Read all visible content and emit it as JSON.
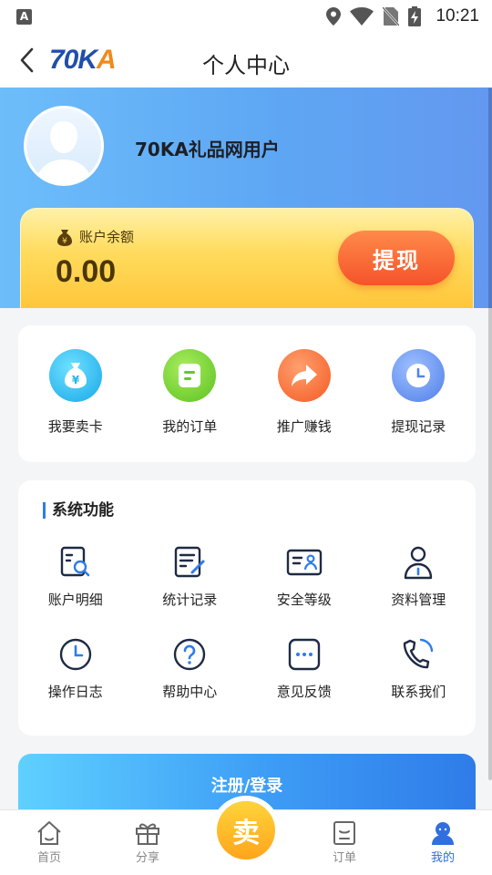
{
  "status": {
    "left_icon": "A",
    "time": "10:21"
  },
  "nav": {
    "title": "个人中心",
    "logo_main": "70K",
    "logo_accent": "A"
  },
  "profile": {
    "username": "70KA礼品网用户"
  },
  "balance": {
    "label": "账户余额",
    "value": "0.00",
    "withdraw_label": "提现"
  },
  "quick_actions": [
    {
      "label": "我要卖卡",
      "icon": "money-bag-icon",
      "color": "#2ec3f0"
    },
    {
      "label": "我的订单",
      "icon": "document-icon",
      "color": "#7cd33a"
    },
    {
      "label": "推广赚钱",
      "icon": "share-arrow-icon",
      "color": "#fa6c3c"
    },
    {
      "label": "提现记录",
      "icon": "clock-icon",
      "color": "#5b8def"
    }
  ],
  "system": {
    "title": "系统功能",
    "items": [
      {
        "label": "账户明细",
        "icon": "account-detail-icon"
      },
      {
        "label": "统计记录",
        "icon": "statistics-icon"
      },
      {
        "label": "安全等级",
        "icon": "id-card-icon"
      },
      {
        "label": "资料管理",
        "icon": "user-icon"
      },
      {
        "label": "操作日志",
        "icon": "clock-icon"
      },
      {
        "label": "帮助中心",
        "icon": "help-icon"
      },
      {
        "label": "意见反馈",
        "icon": "feedback-icon"
      },
      {
        "label": "联系我们",
        "icon": "phone-icon"
      }
    ]
  },
  "login_button": "注册/登录",
  "tabbar": {
    "items": [
      {
        "label": "首页",
        "icon": "home-icon"
      },
      {
        "label": "分享",
        "icon": "gift-icon"
      },
      {
        "label": "卖",
        "icon": "sell-icon"
      },
      {
        "label": "订单",
        "icon": "order-icon"
      },
      {
        "label": "我的",
        "icon": "profile-icon"
      }
    ],
    "active_color": "#2f6fe0",
    "inactive_color": "#888888"
  }
}
